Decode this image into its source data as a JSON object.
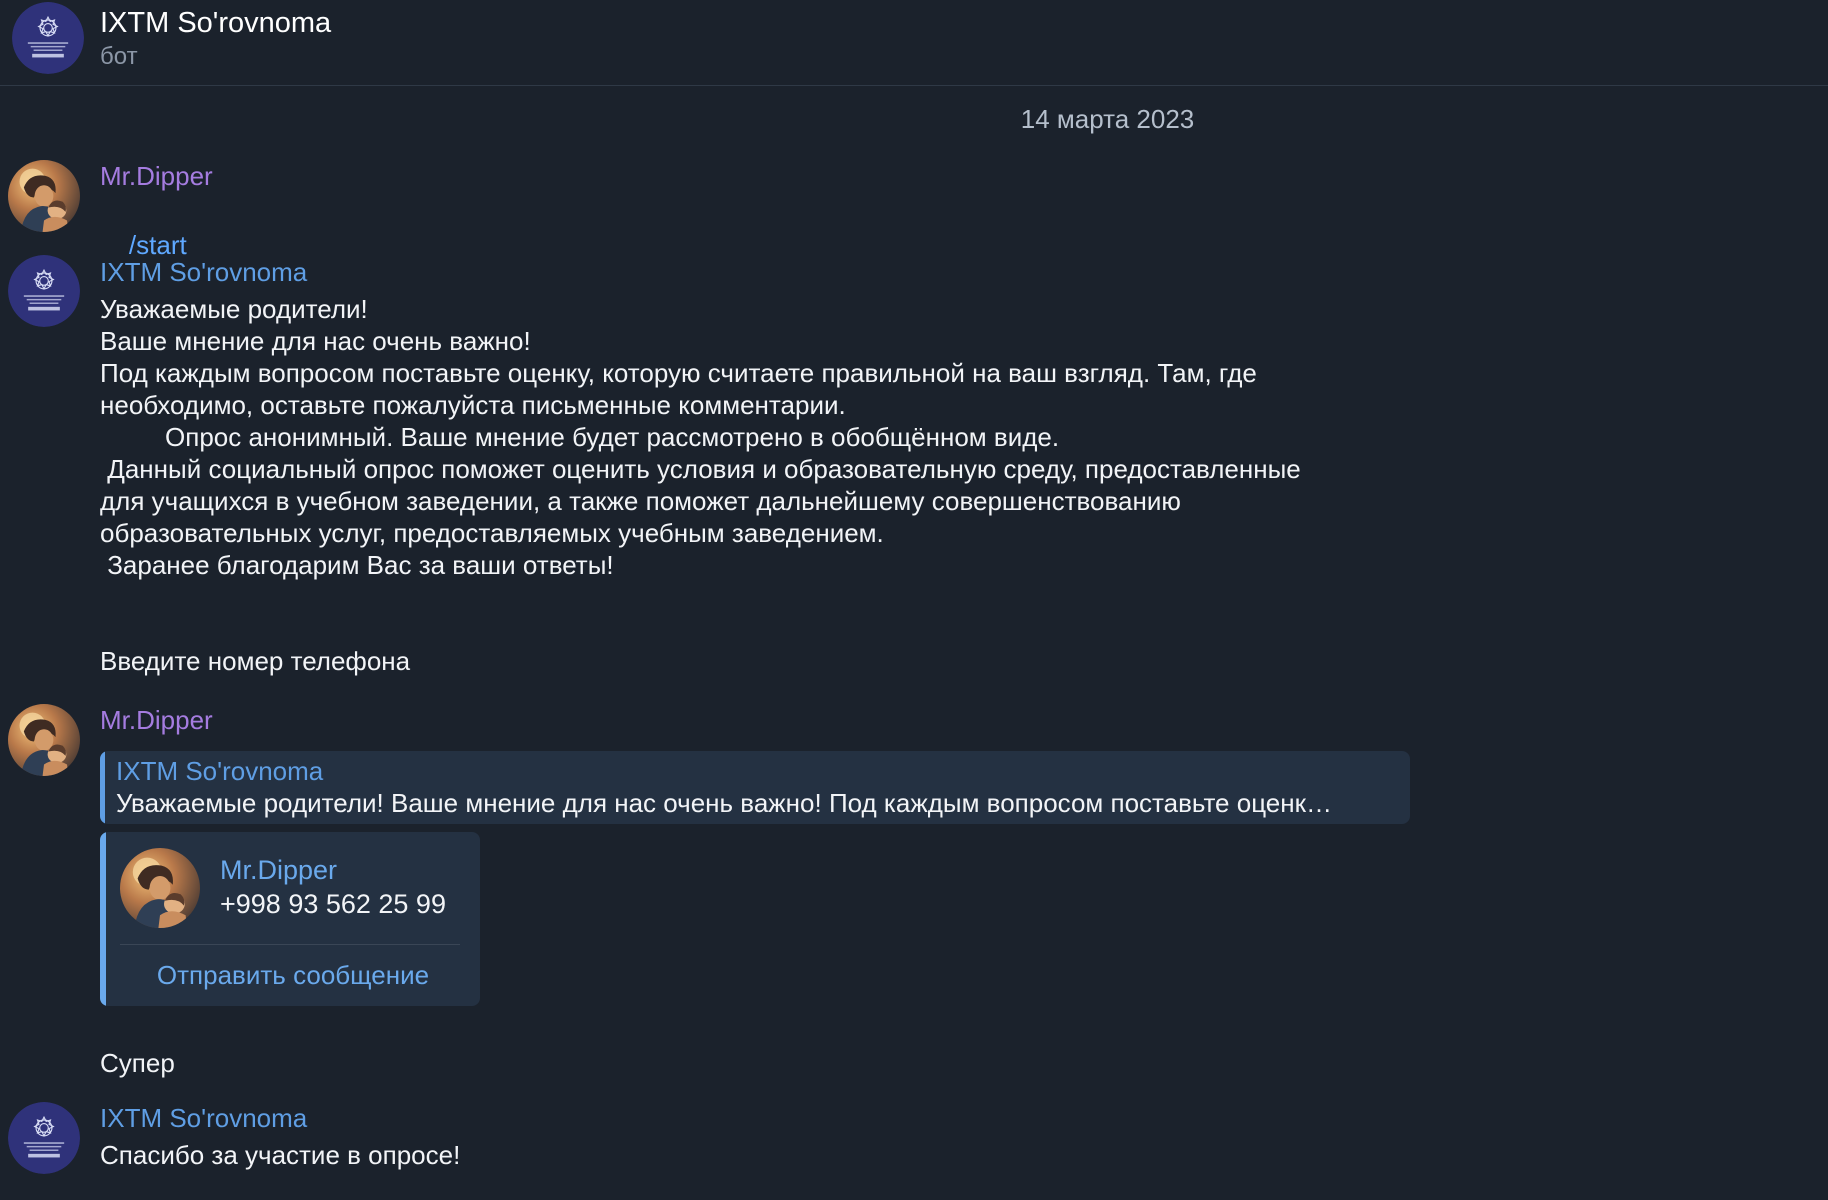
{
  "colors": {
    "background": "#1b222c",
    "user_name": "#a57ce0",
    "bot_name": "#5f9ee4",
    "link": "#5fa8ff",
    "card": "#243142"
  },
  "header": {
    "avatar_icon": "agency-logo-icon",
    "title": "IXTM So'rovnoma",
    "subtitle": "бот"
  },
  "date_separator": "14 марта 2023",
  "messages": [
    {
      "sender": "Mr.Dipper",
      "avatar_icon": "user-photo-avatar",
      "text": "/start"
    },
    {
      "sender": "IXTM So'rovnoma",
      "avatar_icon": "agency-logo-icon",
      "lines": [
        "Уважаемые родители!",
        "Ваше мнение для нас очень важно!",
        "Под каждым вопросом поставьте оценку, которую считаете правильной на ваш взгляд. Там, где",
        "необходимо, оставьте пожалуйста письменные комментарии.",
        "         Опрос анонимный. Ваше мнение будет рассмотрено в обобщённом виде.",
        " Данный социальный опрос поможет оценить условия и образовательную среду, предоставленные",
        "для учащихся в учебном заведении, а также поможет дальнейшему совершенствованию",
        "образовательных услуг, предоставляемых учебным заведением.",
        " Заранее благодарим Вас за ваши ответы!"
      ],
      "extra": "Введите номер телефона"
    },
    {
      "sender": "Mr.Dipper",
      "avatar_icon": "user-photo-avatar",
      "reply": {
        "sender": "IXTM So'rovnoma",
        "text": "Уважаемые родители! Ваше мнение для нас очень важно!  Под каждым вопросом поставьте оценк…"
      },
      "contact": {
        "name": "Mr.Dipper",
        "phone": "+998 93 562 25 99",
        "button": "Отправить сообщение"
      },
      "extra": "Супер"
    },
    {
      "sender": "IXTM So'rovnoma",
      "avatar_icon": "agency-logo-icon",
      "text": "Спасибо за участие в опросе!"
    }
  ]
}
